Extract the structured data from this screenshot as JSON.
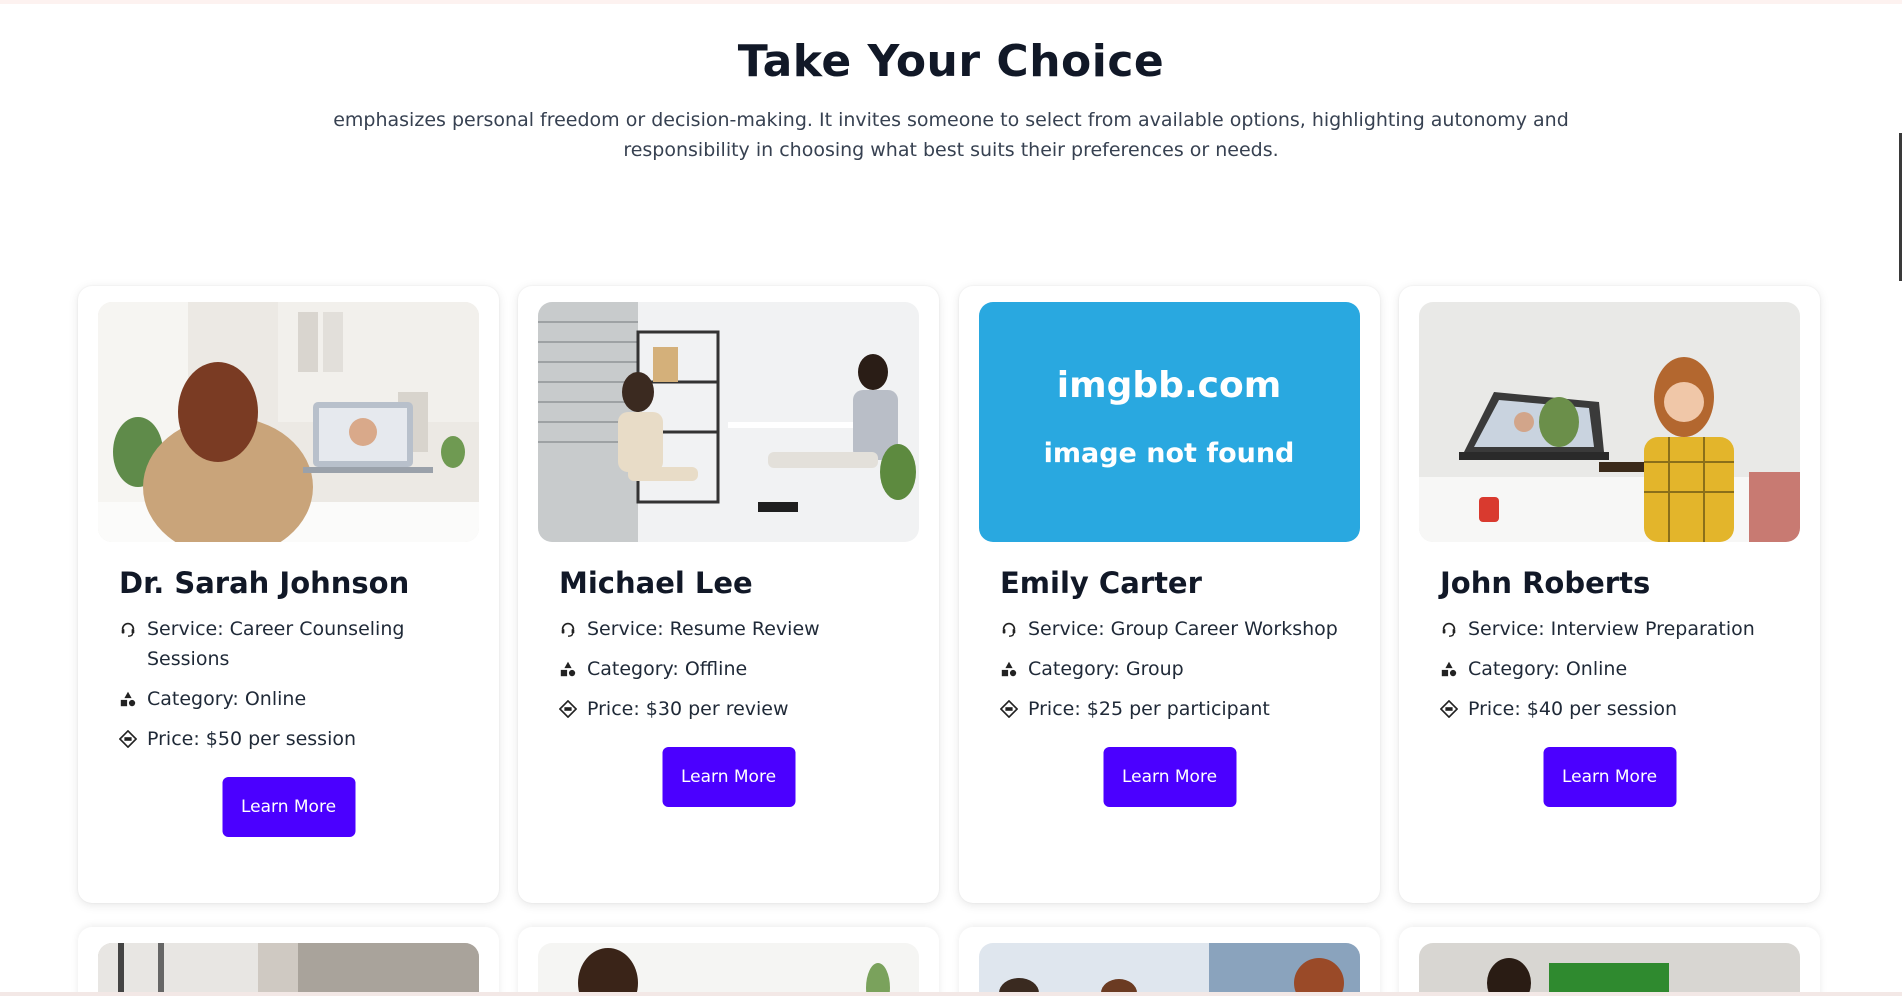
{
  "section": {
    "title": "Take Your Choice",
    "subtitle": "emphasizes personal freedom or decision-making. It invites someone to select from available options, highlighting autonomy and responsibility in choosing what best suits their preferences or needs."
  },
  "cards": [
    {
      "name": "Dr. Sarah Johnson",
      "service": "Service: Career Counseling Sessions",
      "category": "Category: Online",
      "price": "Price: $50 per session",
      "button": "Learn More"
    },
    {
      "name": "Michael Lee",
      "service": "Service: Resume Review",
      "category": "Category: Offline",
      "price": "Price: $30 per review",
      "button": "Learn More"
    },
    {
      "name": "Emily Carter",
      "service": "Service: Group Career Workshop",
      "category": "Category: Group",
      "price": "Price: $25 per participant",
      "button": "Learn More",
      "image_text_1": "imgbb.com",
      "image_text_2": "image not found"
    },
    {
      "name": "John Roberts",
      "service": "Service: Interview Preparation",
      "category": "Category: Online",
      "price": "Price: $40 per session",
      "button": "Learn More"
    }
  ],
  "colors": {
    "button": "#4b00ff",
    "placeholder_bg": "#29a8e0",
    "title": "#111827"
  },
  "icons": {
    "service": "headset-icon",
    "category": "shapes-icon",
    "price": "price-tag-icon"
  }
}
